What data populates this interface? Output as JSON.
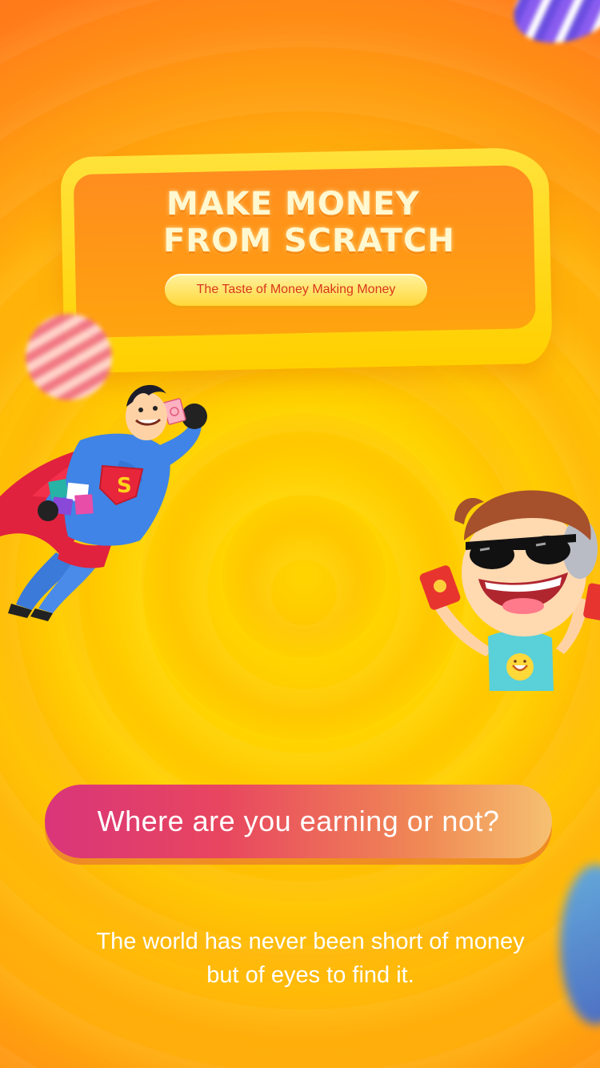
{
  "headline": {
    "line1": "MAKE MONEY",
    "line2": "FROM SCRATCH",
    "tagline": "The Taste of Money Making Money"
  },
  "question": "Where are you earning or not?",
  "footer": {
    "line1": "The world has never been short of money",
    "line2": "but of eyes to find it."
  },
  "illustrations": {
    "left": "flying-superhero-illustration",
    "right": "sunglasses-boy-illustration"
  },
  "colors": {
    "background": "#ffd000",
    "frame": "#ffe23a",
    "frame_inner": "#ff8d1f",
    "tagline_text": "#d9361e",
    "question_gradient_start": "#d9357a",
    "question_gradient_end": "#f6c071"
  }
}
